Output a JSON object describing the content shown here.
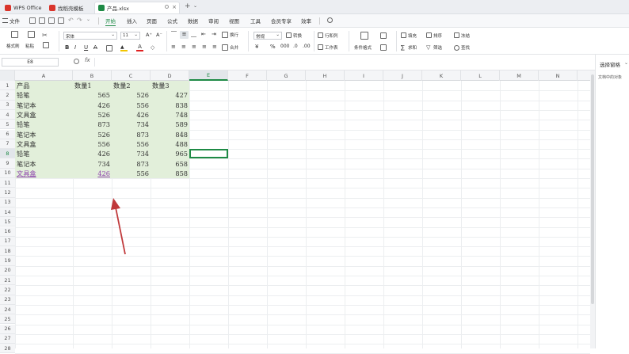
{
  "tabs": [
    {
      "label": "WPS Office",
      "color": "#d9342b"
    },
    {
      "label": "找稻壳模板",
      "color": "#d9342b"
    },
    {
      "label": "产品.xlsx",
      "color": "#1e8a45"
    }
  ],
  "menu": {
    "file": "文件",
    "items": [
      "开始",
      "插入",
      "页面",
      "公式",
      "数据",
      "审阅",
      "视图",
      "工具",
      "会员专享",
      "效率"
    ],
    "active": "开始"
  },
  "ribbon": {
    "format_painter": "格式刷",
    "paste": "粘贴",
    "font_name": "宋体",
    "font_size": "11",
    "wrap": "换行",
    "merge": "合并",
    "number_format": "常规",
    "convert": "转换",
    "row_col": "行和列",
    "worksheet": "工作表",
    "cond_format": "条件格式",
    "fill": "填充",
    "sort": "排序",
    "freeze": "冻结",
    "sum": "求和",
    "filter": "筛选",
    "find": "查找"
  },
  "formula_bar": {
    "name_box": "E8",
    "fx": "fx",
    "value": ""
  },
  "columns": [
    "A",
    "B",
    "C",
    "D",
    "E",
    "F",
    "G",
    "H",
    "I",
    "J",
    "K",
    "L",
    "M",
    "N"
  ],
  "selected_col": "E",
  "selected_row": 8,
  "row_numbers": [
    "1",
    "2",
    "3",
    "4",
    "5",
    "6",
    "7",
    "8",
    "9",
    "10",
    "11",
    "12",
    "13",
    "14",
    "15",
    "16",
    "17",
    "18",
    "19",
    "20",
    "21",
    "22",
    "23",
    "24",
    "25",
    "26",
    "27",
    "28"
  ],
  "sheet": {
    "header": [
      "产品",
      "数量1",
      "数量2",
      "数量3"
    ],
    "rows": [
      [
        "铅笔",
        "565",
        "526",
        "427"
      ],
      [
        "笔记本",
        "426",
        "556",
        "838"
      ],
      [
        "文具盒",
        "526",
        "426",
        "748"
      ],
      [
        "铅笔",
        "873",
        "734",
        "589"
      ],
      [
        "笔记本",
        "526",
        "873",
        "848"
      ],
      [
        "文具盒",
        "556",
        "556",
        "488"
      ],
      [
        "铅笔",
        "426",
        "734",
        "965"
      ],
      [
        "笔记本",
        "734",
        "873",
        "658"
      ],
      [
        "文具盒",
        "426",
        "556",
        "858"
      ]
    ]
  },
  "right_panel": {
    "title": "选择窗格",
    "subtitle": "文档中的对象"
  },
  "colors": {
    "accent": "#1e8a45",
    "range_fill": "#e2efda",
    "arrow": "#c0393b"
  }
}
